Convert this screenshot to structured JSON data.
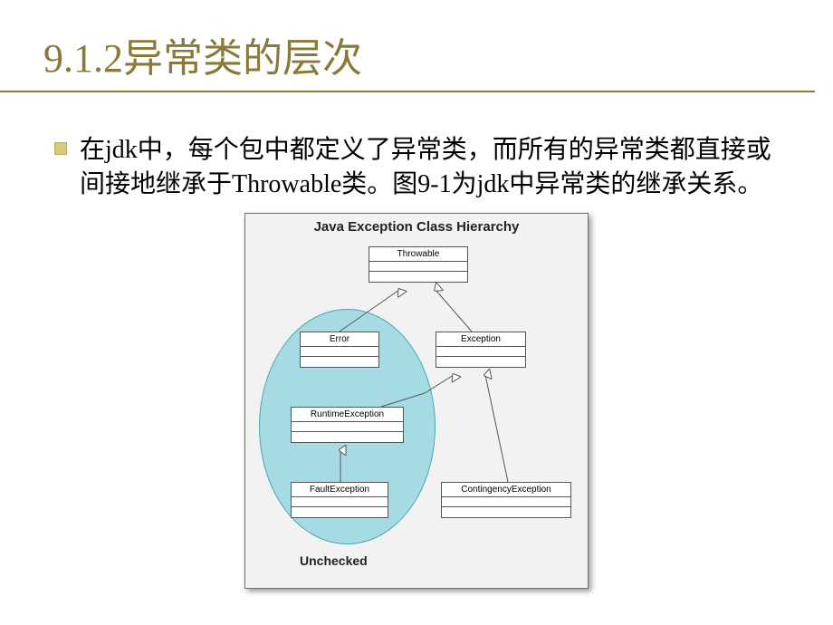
{
  "title": "9.1.2异常类的层次",
  "paragraph": "在jdk中，每个包中都定义了异常类，而所有的异常类都直接或间接地继承于Throwable类。图9-1为jdk中异常类的继承关系。",
  "diagram": {
    "title": "Java Exception Class Hierarchy",
    "unchecked_label": "Unchecked",
    "nodes": {
      "throwable": "Throwable",
      "error": "Error",
      "exception": "Exception",
      "runtime": "RuntimeException",
      "fault": "FaultException",
      "contingency": "ContingencyException"
    }
  }
}
